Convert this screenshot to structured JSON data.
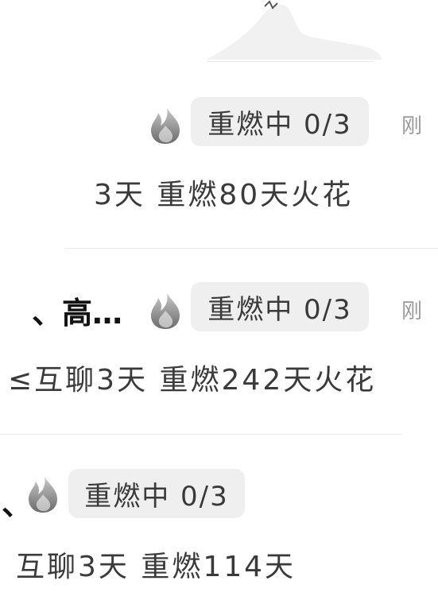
{
  "conversations": [
    {
      "rekindle_badge": "重燃中 0/3",
      "time": "刚",
      "subtitle": "3天 重燃80天火花"
    },
    {
      "name_fragment": "、高…",
      "rekindle_badge": "重燃中 0/3",
      "time": "刚",
      "subtitle": "≤互聊3天 重燃242天火花"
    },
    {
      "name_fragment": "、",
      "rekindle_badge": "重燃中 0/3",
      "subtitle": "互聊3天 重燃114天"
    }
  ],
  "icon_names": {
    "flame": "flame-icon",
    "avatar": "mountain-avatar"
  },
  "colors": {
    "badge_bg": "#efefef",
    "flame_gray": "#9a9a9a",
    "text": "#3a3a3a",
    "time": "#9a9a9a"
  }
}
